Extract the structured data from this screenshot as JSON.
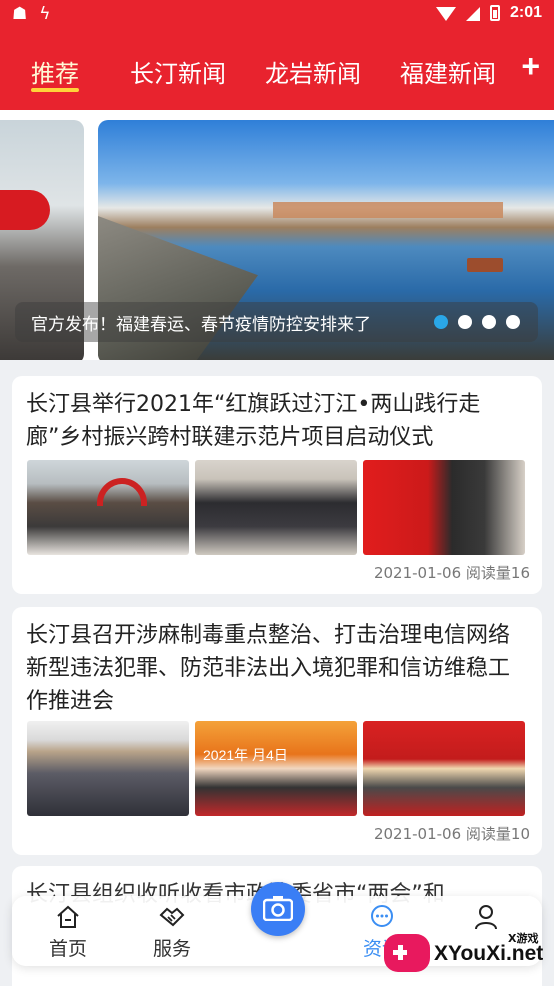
{
  "status_bar": {
    "time": "2:01"
  },
  "nav": {
    "tabs": [
      {
        "label": "推荐"
      },
      {
        "label": "长汀新闻"
      },
      {
        "label": "龙岩新闻"
      },
      {
        "label": "福建新闻"
      }
    ],
    "add_label": "+"
  },
  "carousel": {
    "caption": "官方发布！福建春运、春节疫情防控安排来了",
    "slide_count": 4,
    "active_index": 0
  },
  "articles": [
    {
      "title": "长汀县举行2021年“红旗跃过汀江•两山践行走廊”乡村振兴跨村联建示范片项目启动仪式",
      "date": "2021-01-06",
      "reads_label": "阅读量16"
    },
    {
      "title": "长汀县召开涉麻制毒重点整治、打击治理电信网络新型违法犯罪、防范非法出入境犯罪和信访维稳工作推进会",
      "date": "2021-01-06",
      "reads_label": "阅读量10",
      "thumb_banner": "2021年 月4日"
    },
    {
      "title": "长汀县组织收听收看市政法委省市“两会”和"
    }
  ],
  "tabbar": {
    "items": [
      {
        "label": "首页",
        "icon": "home-icon"
      },
      {
        "label": "服务",
        "icon": "handshake-icon"
      },
      {
        "label": "资讯",
        "icon": "chat-icon"
      },
      {
        "label": "",
        "icon": "user-icon"
      }
    ],
    "center_icon": "camera-icon",
    "active_color": "#3b8ef3"
  },
  "watermark": {
    "text": "XYouXi.net",
    "small": "X游戏"
  },
  "colors": {
    "brand_red": "#e8232e",
    "accent_yellow": "#ffd33a",
    "dot_active": "#2aa7e8"
  }
}
